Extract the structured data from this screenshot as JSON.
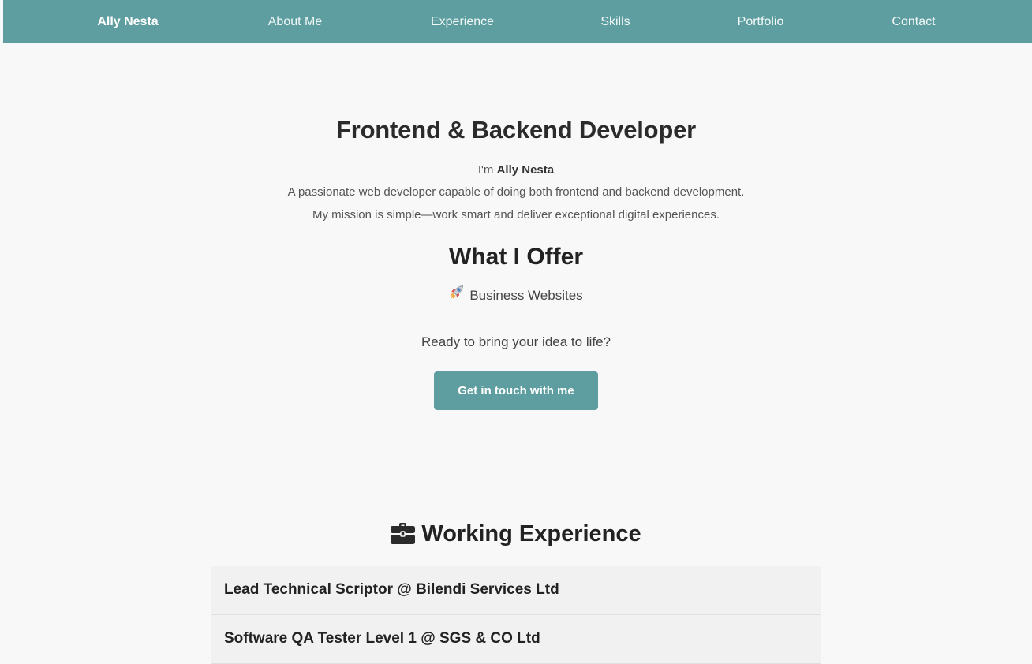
{
  "nav": {
    "brand": "Ally Nesta",
    "items": [
      {
        "label": "About Me"
      },
      {
        "label": "Experience"
      },
      {
        "label": "Skills"
      },
      {
        "label": "Portfolio"
      },
      {
        "label": "Contact"
      }
    ]
  },
  "hero": {
    "title": "Frontend & Backend Developer",
    "intro_prefix": "I'm",
    "intro_name": "Ally Nesta",
    "description_lines": [
      "A passionate web developer capable of doing both frontend and backend development.",
      "My mission is simple—work smart and deliver exceptional digital experiences."
    ]
  },
  "offer": {
    "title": "What I Offer",
    "item_icon": "rocket-icon",
    "item_label": "Business Websites"
  },
  "cta": {
    "text": "Ready to bring your idea to life?",
    "button_label": "Get in touch with me"
  },
  "experience": {
    "icon": "briefcase-icon",
    "title": "Working Experience",
    "items": [
      {
        "label": "Lead Technical Scriptor @ Bilendi Services Ltd"
      },
      {
        "label": "Software QA Tester Level 1 @ SGS & CO Ltd"
      }
    ]
  },
  "colors": {
    "accent": "#5f9ea0",
    "background": "#f8f8f8"
  }
}
